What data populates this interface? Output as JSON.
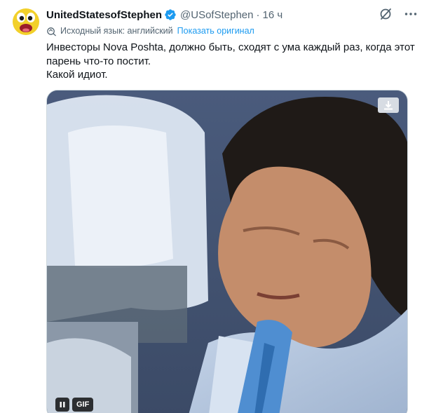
{
  "author": {
    "display_name": "UnitedStatesofStephen",
    "handle": "@USofStephen",
    "time": "16 ч",
    "verified": true
  },
  "translation": {
    "source_text": "Исходный язык: английский",
    "show_original_label": "Показать оригинал"
  },
  "tweet": {
    "lines": [
      "Инвесторы Nova Poshta, должно быть, сходят с ума каждый раз, когда этот парень что-то постит.",
      "Какой идиот."
    ]
  },
  "media": {
    "type": "gif",
    "badge_label": "GIF"
  },
  "icons": {
    "verified": "verified-badge-icon",
    "grok": "grok-icon",
    "more": "more-icon",
    "translate": "translate-icon",
    "download": "download-icon",
    "pause": "pause-icon"
  },
  "colors": {
    "link": "#1d9bf0",
    "muted": "#536471",
    "verified": "#1d9bf0",
    "text": "#0f1419"
  }
}
